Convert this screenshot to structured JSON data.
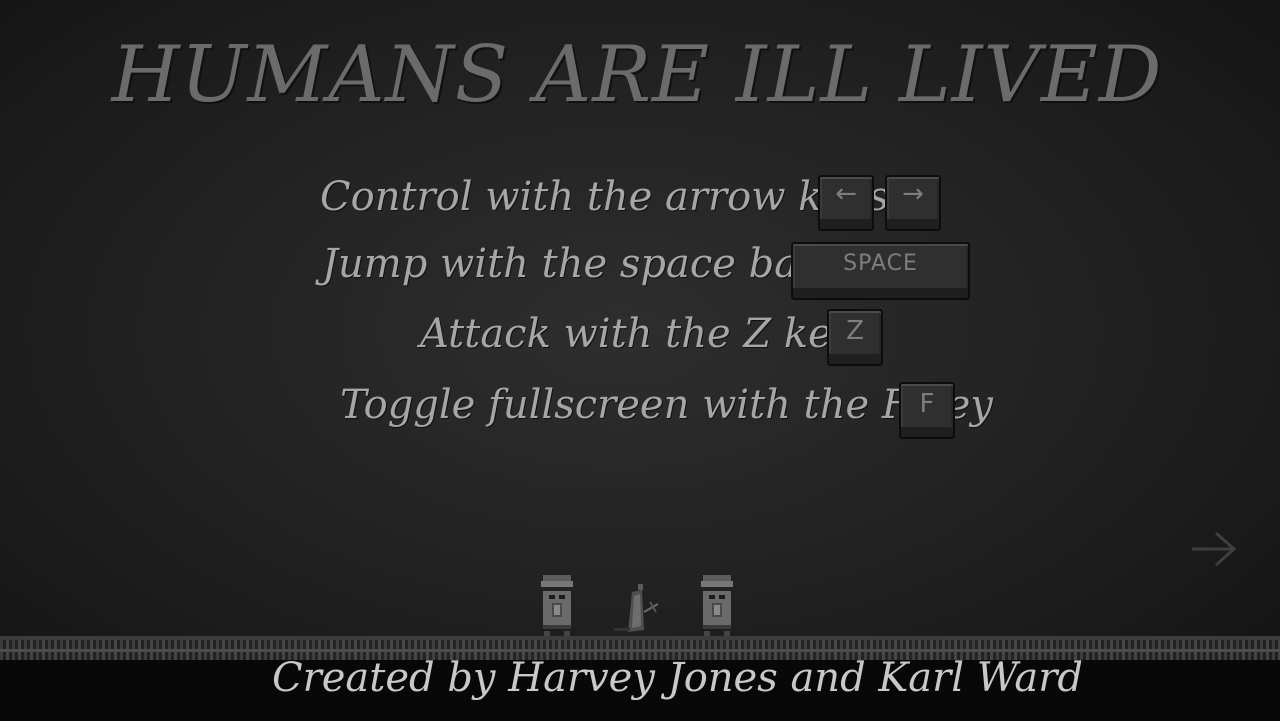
{
  "title": "HUMANS ARE ILL LIVED",
  "instructions": [
    {
      "text": "Control with the arrow keys",
      "keys": [
        "←",
        "→"
      ]
    },
    {
      "text": "Jump with the space bar",
      "keys": [
        "SPACE"
      ]
    },
    {
      "text": "Attack with the Z key",
      "keys": [
        "Z"
      ]
    },
    {
      "text": "Toggle fullscreen with the F key",
      "keys": [
        "F"
      ]
    }
  ],
  "next_icon": "arrow-right-icon",
  "credits": "Created by Harvey Jones and Karl Ward",
  "colors": {
    "background": "#232323",
    "title": "#6b6b6b",
    "instruction_text": "#a6a6a6",
    "key_face": "#2f2f2f",
    "credits": "#c8c8c8"
  }
}
